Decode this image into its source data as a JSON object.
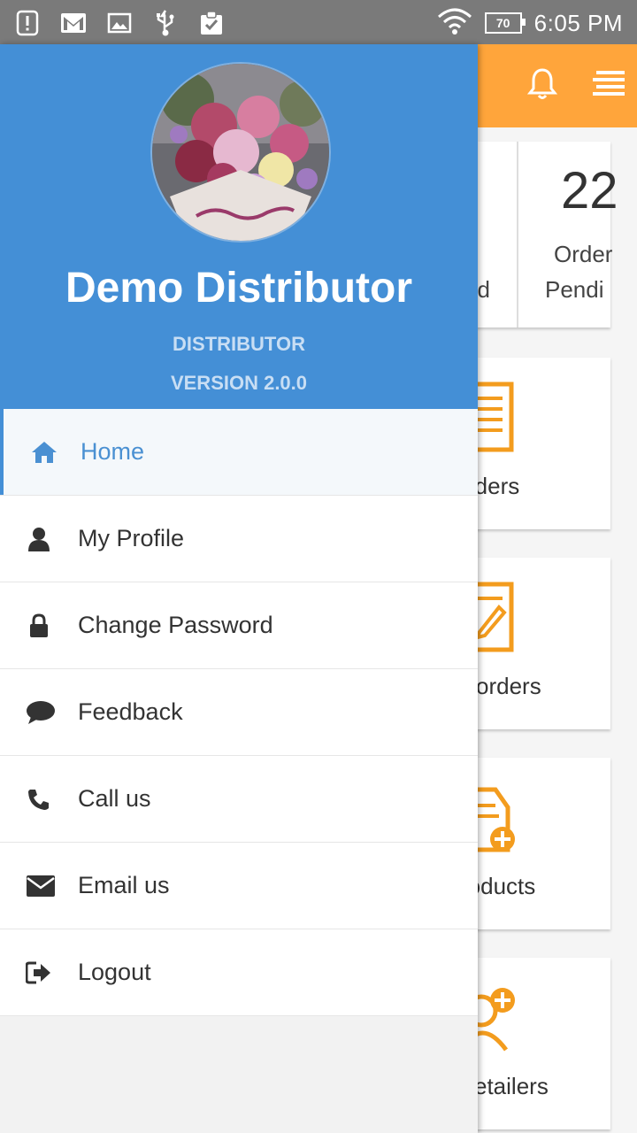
{
  "status_bar": {
    "battery": "70",
    "time": "6:05 PM"
  },
  "background_app": {
    "stats": [
      {
        "number": "",
        "label_line1": "",
        "label_line2": "d"
      },
      {
        "number": "22",
        "label_line1": "Order",
        "label_line2": "Pendi"
      }
    ],
    "cards": [
      {
        "label": "rders"
      },
      {
        "label": " orders"
      },
      {
        "label": "roducts"
      },
      {
        "label": "etailers"
      }
    ]
  },
  "drawer": {
    "user_name": "Demo Distributor",
    "role": "DISTRIBUTOR",
    "version": "VERSION 2.0.0",
    "menu": [
      {
        "label": "Home",
        "icon": "home-icon"
      },
      {
        "label": "My Profile",
        "icon": "user-icon"
      },
      {
        "label": "Change Password",
        "icon": "lock-icon"
      },
      {
        "label": "Feedback",
        "icon": "comment-icon"
      },
      {
        "label": "Call us",
        "icon": "phone-icon"
      },
      {
        "label": "Email us",
        "icon": "envelope-icon"
      },
      {
        "label": "Logout",
        "icon": "sign-out-icon"
      }
    ]
  },
  "colors": {
    "drawer_header": "#448fd6",
    "app_bar": "#ffa53b",
    "accent_orange": "#f39c1e",
    "active_text": "#4a90d2"
  }
}
